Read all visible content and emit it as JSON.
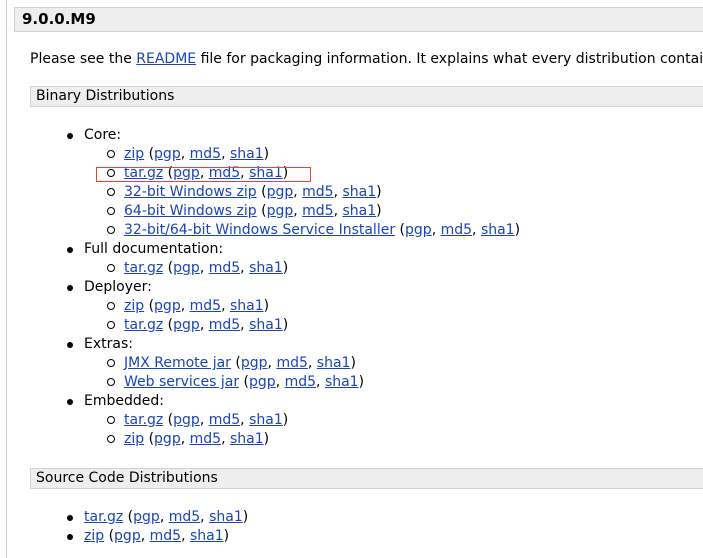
{
  "version_header": "9.0.0.M9",
  "intro": {
    "before": "Please see the ",
    "link": "README",
    "after": " file for packaging information. It explains what every distribution contains."
  },
  "binary": {
    "heading": "Binary Distributions",
    "core_label": "Core:",
    "core_zip": "zip",
    "core_targz": "tar.gz",
    "core_win32": "32-bit Windows zip",
    "core_win64": "64-bit Windows zip",
    "core_installer": "32-bit/64-bit Windows Service Installer",
    "fulldoc_label": "Full documentation:",
    "fulldoc_targz": "tar.gz",
    "deployer_label": "Deployer:",
    "deployer_zip": "zip",
    "deployer_targz": "tar.gz",
    "extras_label": "Extras:",
    "extras_jmx": "JMX Remote jar",
    "extras_ws": "Web services jar",
    "embedded_label": "Embedded:",
    "embedded_targz": "tar.gz",
    "embedded_zip": "zip"
  },
  "source": {
    "heading": "Source Code Distributions",
    "targz": "tar.gz",
    "zip": "zip"
  },
  "sig": {
    "open": " (",
    "pgp": "pgp",
    "sep": ", ",
    "md5": "md5",
    "sha1": "sha1",
    "close": ")"
  },
  "colors": {
    "link": "#1a44b8",
    "header_bg": "#eeeeee",
    "highlight": "#e8443a"
  }
}
